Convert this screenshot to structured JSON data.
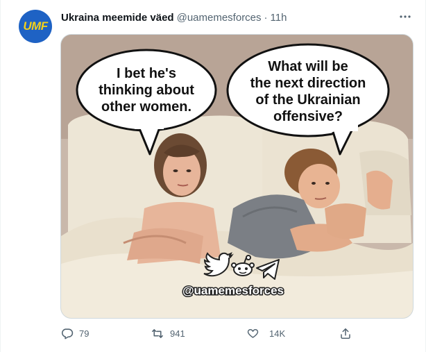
{
  "tweet": {
    "avatar_text": "UMF",
    "display_name": "Ukraina meemide väed",
    "handle": "@uamemesforces",
    "separator": "·",
    "time": "11h"
  },
  "media": {
    "bubble_left": [
      "I bet he's",
      "thinking about",
      "other women."
    ],
    "bubble_right": [
      "What will be",
      "the next direction",
      "of the Ukrainian",
      "offensive?"
    ],
    "watermark": "@uamemesforces"
  },
  "actions": {
    "replies": "79",
    "retweets": "941",
    "likes": "14K"
  },
  "colors": {
    "text_primary": "#0f1419",
    "text_secondary": "#536471",
    "border": "#cfd9de",
    "avatar_bg": "#1e62c4",
    "avatar_fg": "#f4d11a"
  },
  "icons": [
    "more-icon",
    "reply-icon",
    "retweet-icon",
    "like-icon",
    "share-icon",
    "twitter-bird-icon",
    "reddit-icon",
    "telegram-icon"
  ]
}
